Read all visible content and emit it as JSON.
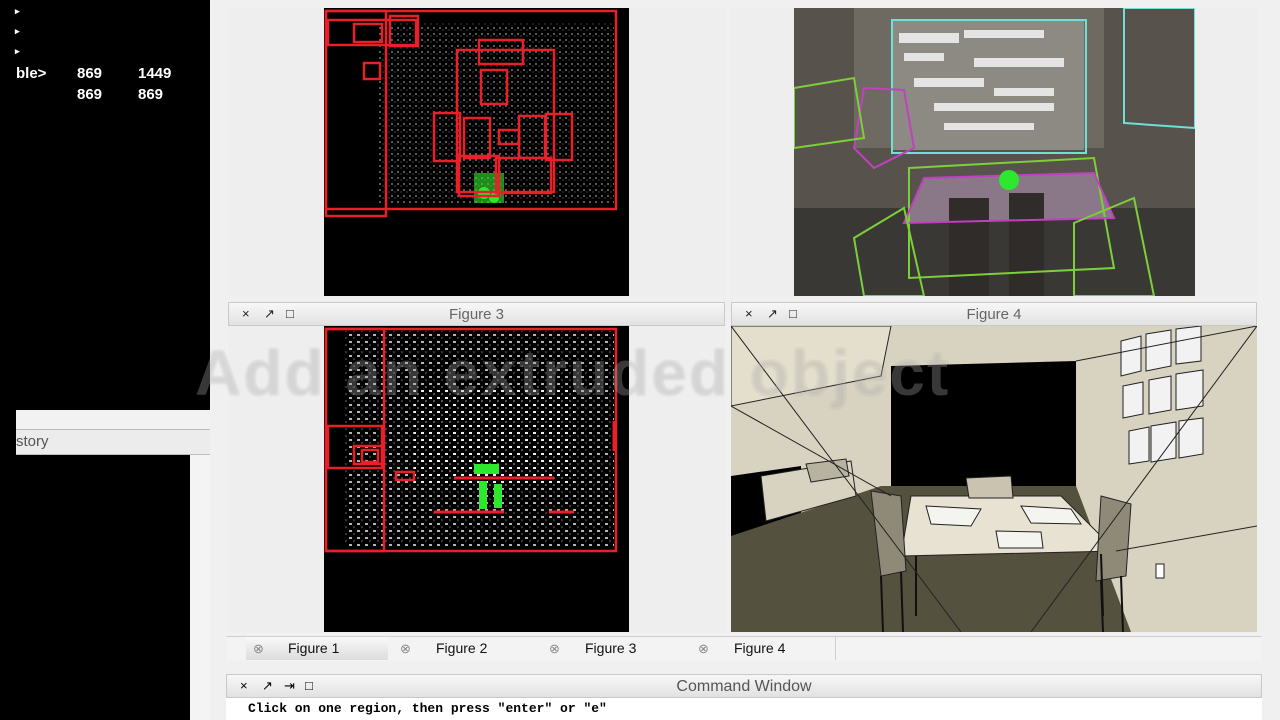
{
  "workspace": {
    "rows": [
      {
        "name": "ble>",
        "v1": "869",
        "v2": "1449"
      },
      {
        "name": "",
        "v1": "869",
        "v2": "869"
      }
    ],
    "history_title": "story"
  },
  "figures": [
    {
      "title": "Figure 3"
    },
    {
      "title": "Figure 4"
    }
  ],
  "controls": {
    "close": "×",
    "undock": "↗",
    "maximize": "□",
    "pin": "⇥"
  },
  "tabs": [
    {
      "label": "Figure 1",
      "active": true
    },
    {
      "label": "Figure 2",
      "active": false
    },
    {
      "label": "Figure 3",
      "active": false
    },
    {
      "label": "Figure 4",
      "active": false
    }
  ],
  "command_window": {
    "title": "Command Window",
    "text": "Click on one region, then press \"enter\" or \"e\""
  },
  "overlay": {
    "watermark": "Add an extruded object"
  },
  "colors": {
    "box_red": "#e8202a",
    "points_green": "#2ee82e",
    "edge_green": "#7dcf3a",
    "edge_cyan": "#6fe0d8",
    "edge_magenta": "#c040c0"
  }
}
